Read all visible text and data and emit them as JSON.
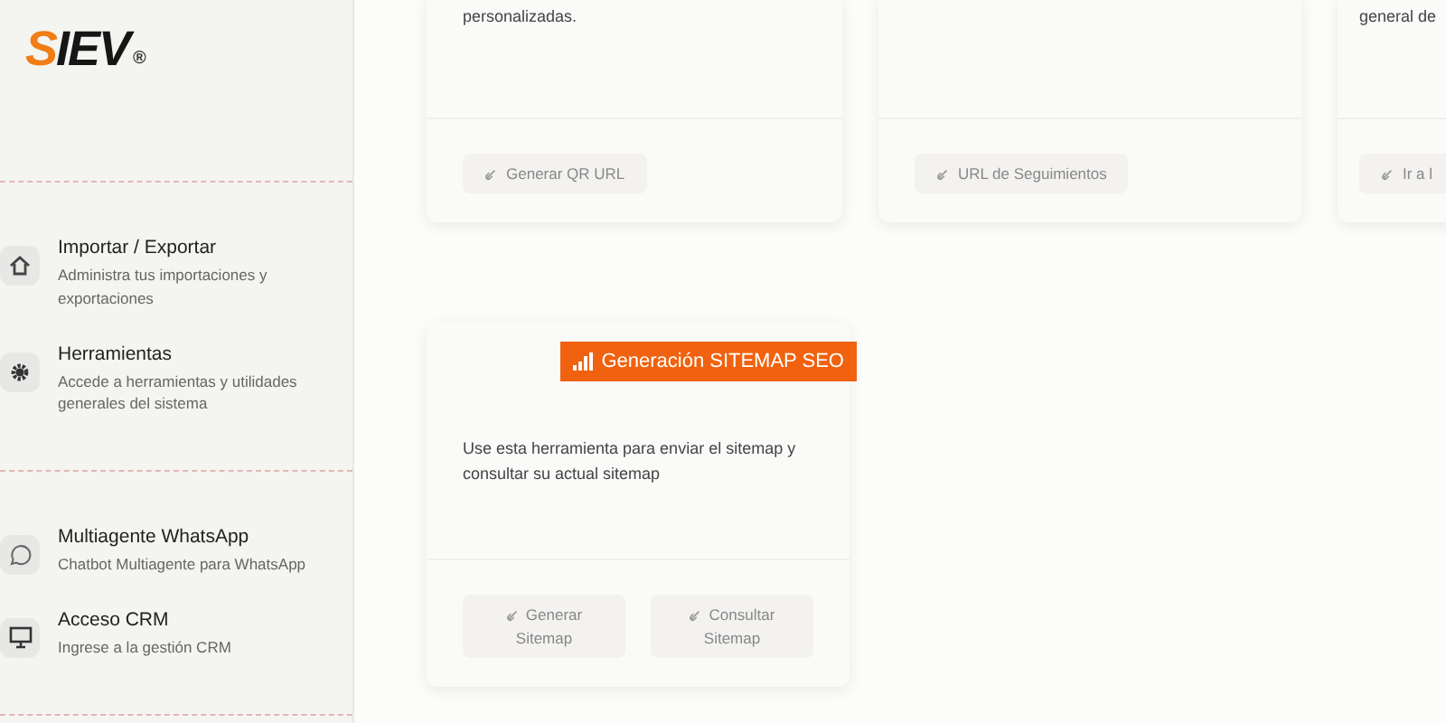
{
  "sidebar": {
    "logo": {
      "first": "S",
      "rest": "IEV",
      "mark": "®"
    },
    "groups": [
      [
        {
          "title": "Importar / Exportar",
          "description": "Administra tus importaciones y exportaciones"
        },
        {
          "title": "Herramientas",
          "description": "Accede a herramientas y utilidades generales del sistema"
        }
      ],
      [
        {
          "title": "Multiagente WhatsApp",
          "description": "Chatbot Multiagente para WhatsApp"
        },
        {
          "title": "Acceso CRM",
          "description": "Ingrese a la gestión CRM"
        }
      ]
    ]
  },
  "top_cards": [
    {
      "text": "personalizadas.",
      "buttons": [
        "Generar QR URL"
      ]
    },
    {
      "buttons": [
        "URL de Seguimientos"
      ]
    },
    {
      "text": "general de",
      "buttons": [
        "Ir a l"
      ]
    }
  ],
  "tool_card": {
    "badge": "Generación SITEMAP SEO",
    "text": "Use esta herramienta para enviar el sitemap y consultar su actual sitemap",
    "buttons": [
      "Generar Sitemap",
      "Consultar Sitemap"
    ]
  }
}
